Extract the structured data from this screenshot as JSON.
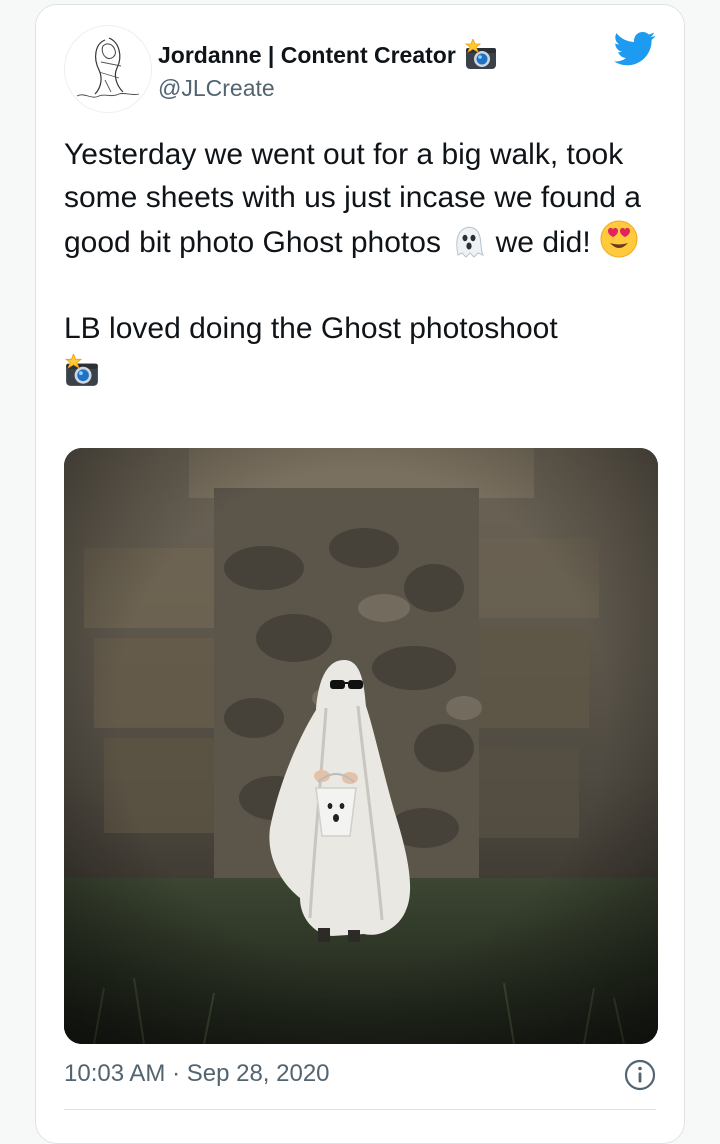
{
  "tweet": {
    "display_name": "Jordanne | Content Creator",
    "handle": "@JLCreate",
    "text_line_1": "Yesterday we went out for a big walk, took some sheets with us just incase we found a good bit photo Ghost photos",
    "text_line_1_end": "we did!",
    "text_line_2": "LB loved doing the Ghost photoshoot",
    "timestamp": "10:03 AM · Sep 28, 2020"
  },
  "icons": {
    "name_suffix": "camera-flash-icon",
    "ghost_emoji": "ghost-icon",
    "heart_eyes_emoji": "heart-eyes-icon",
    "line_end_emoji": "camera-flash-icon",
    "brand": "twitter-bird-icon",
    "info": "info-icon"
  },
  "colors": {
    "brand_blue": "#1d9bf0",
    "text_primary": "#0f1419",
    "text_secondary": "#536471"
  }
}
